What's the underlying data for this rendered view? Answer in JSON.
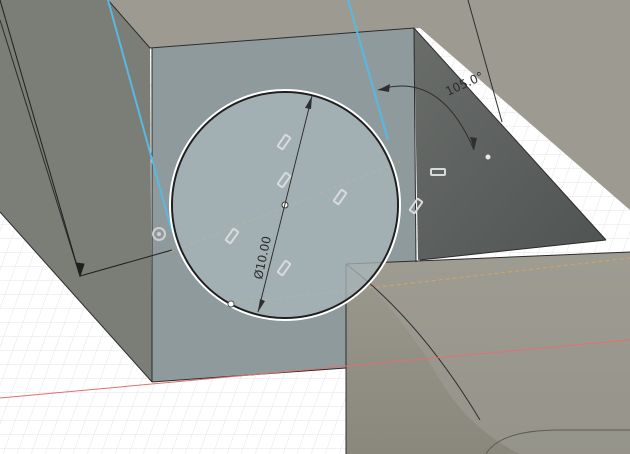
{
  "sketch": {
    "diameter_dimension": "Ø10.00",
    "angle_dimension": "105.0°"
  },
  "colors": {
    "grid_line": "#e6e6e6",
    "body_light": "#9c9a8e",
    "body_mid": "#7b7d79",
    "body_dark": "#5b5e5d",
    "sketch_face": "#8d9a9d",
    "profile_fill": "#a9b6ba",
    "construction_blue": "#58b9e3",
    "axis_red": "#e07070",
    "construction_orange": "#d3a36b",
    "dimension_line": "#2e2e2e"
  }
}
